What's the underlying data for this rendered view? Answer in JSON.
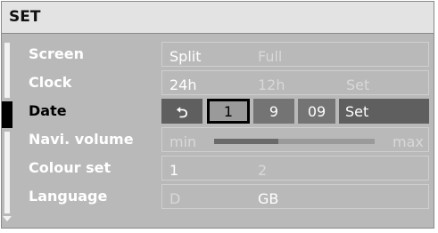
{
  "title": "SET",
  "rows": [
    {
      "label": "Screen",
      "options": [
        "Split",
        "Full"
      ]
    },
    {
      "label": "Clock",
      "options": [
        "24h",
        "12h",
        "Set"
      ]
    },
    {
      "label": "Date",
      "back": "⮌",
      "day": "1",
      "month": "9",
      "year": "09",
      "set": "Set"
    },
    {
      "label": "Navi. volume",
      "min": "min",
      "max": "max",
      "level": 0.4
    },
    {
      "label": "Colour set",
      "options": [
        "1",
        "2"
      ]
    },
    {
      "label": "Language",
      "options": [
        "D",
        "GB"
      ]
    }
  ],
  "icons": {
    "scroll_down": "scroll-down-arrow-icon",
    "back": "back-arrow-icon"
  }
}
